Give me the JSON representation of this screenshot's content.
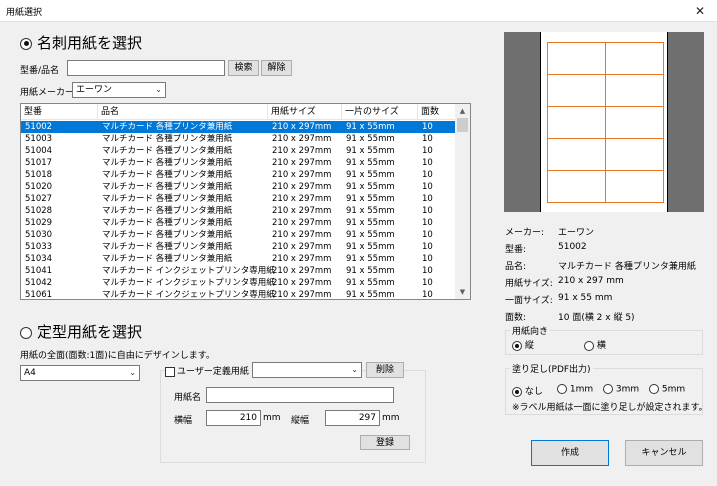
{
  "window": {
    "title": "用紙選択",
    "close_glyph": "✕"
  },
  "business": {
    "title": "名刺用紙を選択",
    "search_label": "型番/品名",
    "search_value": "",
    "search_button": "検索",
    "clear_button": "解除",
    "maker_label": "用紙メーカー",
    "maker_value": "エーワン",
    "columns": [
      "型番",
      "品名",
      "用紙サイズ",
      "一片のサイズ",
      "面数"
    ],
    "rows": [
      [
        "51002",
        "マルチカード 各種プリンタ兼用紙",
        "210 x 297mm",
        "91 x 55mm",
        "10"
      ],
      [
        "51003",
        "マルチカード 各種プリンタ兼用紙",
        "210 x 297mm",
        "91 x 55mm",
        "10"
      ],
      [
        "51004",
        "マルチカード 各種プリンタ兼用紙",
        "210 x 297mm",
        "91 x 55mm",
        "10"
      ],
      [
        "51017",
        "マルチカード 各種プリンタ兼用紙",
        "210 x 297mm",
        "91 x 55mm",
        "10"
      ],
      [
        "51018",
        "マルチカード 各種プリンタ兼用紙",
        "210 x 297mm",
        "91 x 55mm",
        "10"
      ],
      [
        "51020",
        "マルチカード 各種プリンタ兼用紙",
        "210 x 297mm",
        "91 x 55mm",
        "10"
      ],
      [
        "51027",
        "マルチカード 各種プリンタ兼用紙",
        "210 x 297mm",
        "91 x 55mm",
        "10"
      ],
      [
        "51028",
        "マルチカード 各種プリンタ兼用紙",
        "210 x 297mm",
        "91 x 55mm",
        "10"
      ],
      [
        "51029",
        "マルチカード 各種プリンタ兼用紙",
        "210 x 297mm",
        "91 x 55mm",
        "10"
      ],
      [
        "51030",
        "マルチカード 各種プリンタ兼用紙",
        "210 x 297mm",
        "91 x 55mm",
        "10"
      ],
      [
        "51033",
        "マルチカード 各種プリンタ兼用紙",
        "210 x 297mm",
        "91 x 55mm",
        "10"
      ],
      [
        "51034",
        "マルチカード 各種プリンタ兼用紙",
        "210 x 297mm",
        "91 x 55mm",
        "10"
      ],
      [
        "51041",
        "マルチカード インクジェットプリンタ専用紙",
        "210 x 297mm",
        "91 x 55mm",
        "10"
      ],
      [
        "51042",
        "マルチカード インクジェットプリンタ専用紙",
        "210 x 297mm",
        "91 x 55mm",
        "10"
      ],
      [
        "51061",
        "マルチカード インクジェットプリンタ専用紙",
        "210 x 297mm",
        "91 x 55mm",
        "10"
      ]
    ],
    "scroll_up": "▲",
    "scroll_down": "▼"
  },
  "standard": {
    "title": "定型用紙を選択",
    "description": "用紙の全面(面数:1面)に自由にデザインします。",
    "size_value": "A4",
    "user_defined_label": "ユーザー定義用紙",
    "user_defined_value": "",
    "delete_button": "削除",
    "paper_name_label": "用紙名",
    "paper_name_value": "",
    "width_label": "横幅",
    "width_value": "210",
    "width_unit": "mm",
    "height_label": "縦幅",
    "height_value": "297",
    "height_unit": "mm",
    "register_button": "登録"
  },
  "info": {
    "maker_key": "メーカー:",
    "maker_val": "エーワン",
    "model_key": "型番:",
    "model_val": "51002",
    "name_key": "品名:",
    "name_val": "マルチカード 各種プリンタ兼用紙",
    "size_key": "用紙サイズ:",
    "size_val": "210 x 297 mm",
    "piece_key": "一面サイズ:",
    "piece_val": "91 x 55 mm",
    "count_key": "面数:",
    "count_val": "10 面(横 2 x 縦 5)"
  },
  "orientation": {
    "legend": "用紙向き",
    "portrait": "縦",
    "landscape": "横"
  },
  "bleed": {
    "legend": "塗り足し(PDF出力)",
    "options": [
      "なし",
      "1mm",
      "3mm",
      "5mm"
    ],
    "note": "※ラベル用紙は一面に塗り足しが設定されます。"
  },
  "preview": {
    "grid_color": "#e87722",
    "cols": 2,
    "rows": 5
  },
  "footer": {
    "create_button": "作成",
    "cancel_button": "キャンセル"
  },
  "colors": {
    "selection": "#0078d7"
  }
}
